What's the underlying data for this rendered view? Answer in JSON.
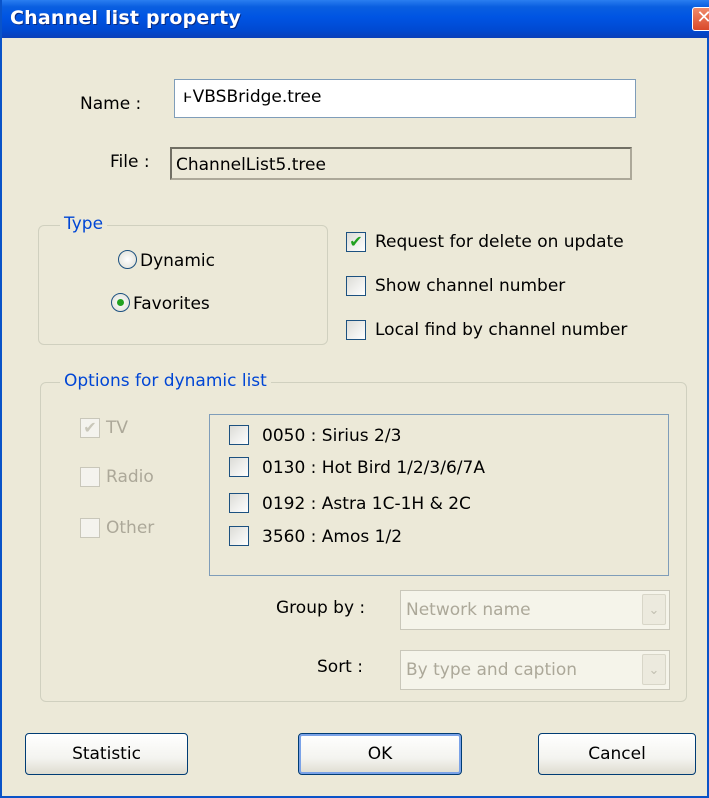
{
  "window": {
    "title": "Channel list property",
    "close_glyph": "✕"
  },
  "fields": {
    "name_label": "Name :",
    "name_value": "ⱶVBSBridge.tree",
    "file_label": "File :",
    "file_value": "ChannelList5.tree"
  },
  "type_group": {
    "legend": "Type",
    "options": [
      {
        "label": "Dynamic",
        "selected": false
      },
      {
        "label": "Favorites",
        "selected": true
      }
    ]
  },
  "checkboxes": [
    {
      "label": "Request for delete on update",
      "checked": true
    },
    {
      "label": "Show channel number",
      "checked": false
    },
    {
      "label": "Local find by channel number",
      "checked": false
    }
  ],
  "dynamic_group": {
    "legend": "Options for dynamic list",
    "kinds": [
      {
        "label": "TV",
        "checked": true
      },
      {
        "label": "Radio",
        "checked": false
      },
      {
        "label": "Other",
        "checked": false
      }
    ],
    "satellites": [
      {
        "label": "0050 : Sirius 2/3",
        "checked": false
      },
      {
        "label": "0130 : Hot Bird 1/2/3/6/7A",
        "checked": false
      },
      {
        "label": "0192 : Astra 1C-1H & 2C",
        "checked": false
      },
      {
        "label": "3560 : Amos 1/2",
        "checked": false
      }
    ],
    "group_by_label": "Group by :",
    "group_by_value": "Network name",
    "sort_label": "Sort :",
    "sort_value": "By type and caption"
  },
  "buttons": {
    "statistic": "Statistic",
    "ok": "OK",
    "cancel": "Cancel"
  },
  "icons": {
    "check": "✔",
    "dropdown": "⌄"
  },
  "colors": {
    "title_bar": "#0054e3",
    "group_legend": "#0046d5",
    "check_mark": "#21a121"
  }
}
